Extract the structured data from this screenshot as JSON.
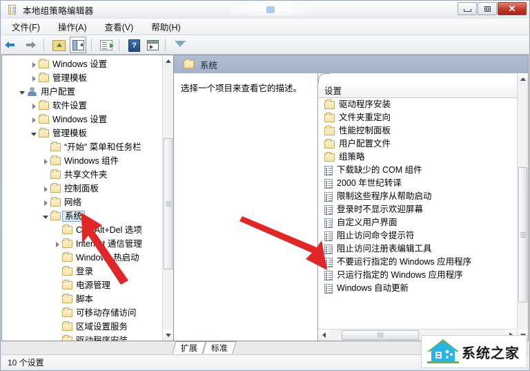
{
  "window": {
    "title": "本地组策略编辑器",
    "icon": "document-policy-icon",
    "controls": {
      "minimize": "–",
      "maximize": "□",
      "close": "✕"
    }
  },
  "menubar": {
    "items": [
      {
        "label": "文件(F)",
        "name": "menu-file"
      },
      {
        "label": "操作(A)",
        "name": "menu-action"
      },
      {
        "label": "查看(V)",
        "name": "menu-view"
      },
      {
        "label": "帮助(H)",
        "name": "menu-help"
      }
    ]
  },
  "toolbar": {
    "buttons": [
      {
        "name": "back-button",
        "icon": "arrow-left-icon"
      },
      {
        "name": "forward-button",
        "icon": "arrow-right-icon"
      },
      {
        "name": "up-one-level-button",
        "icon": "folder-up-icon"
      },
      {
        "name": "show-hide-console-tree-button",
        "icon": "console-tree-icon"
      },
      {
        "name": "export-list-button",
        "icon": "export-list-icon"
      },
      {
        "name": "help-button",
        "icon": "help-question-icon"
      },
      {
        "name": "show-hide-action-pane-button",
        "icon": "action-pane-icon"
      },
      {
        "name": "filter-button",
        "icon": "filter-funnel-icon"
      }
    ]
  },
  "tree": {
    "items": [
      {
        "label": "Windows 设置",
        "indent": 2,
        "expander": "closed",
        "icon": "folder-icon",
        "selected": false
      },
      {
        "label": "管理模板",
        "indent": 2,
        "expander": "closed",
        "icon": "folder-icon",
        "selected": false
      },
      {
        "label": "用户配置",
        "indent": 1,
        "expander": "open",
        "icon": "user-config-icon",
        "selected": false
      },
      {
        "label": "软件设置",
        "indent": 2,
        "expander": "closed",
        "icon": "folder-icon",
        "selected": false
      },
      {
        "label": "Windows 设置",
        "indent": 2,
        "expander": "closed",
        "icon": "folder-icon",
        "selected": false
      },
      {
        "label": "管理模板",
        "indent": 2,
        "expander": "open",
        "icon": "folder-icon",
        "selected": false
      },
      {
        "label": "“开始” 菜单和任务栏",
        "indent": 3,
        "expander": "none",
        "icon": "folder-icon",
        "selected": false
      },
      {
        "label": "Windows 组件",
        "indent": 3,
        "expander": "closed",
        "icon": "folder-icon",
        "selected": false
      },
      {
        "label": "共享文件夹",
        "indent": 3,
        "expander": "none",
        "icon": "folder-icon",
        "selected": false
      },
      {
        "label": "控制面板",
        "indent": 3,
        "expander": "closed",
        "icon": "folder-icon",
        "selected": false
      },
      {
        "label": "网络",
        "indent": 3,
        "expander": "closed",
        "icon": "folder-icon",
        "selected": false
      },
      {
        "label": "系统",
        "indent": 3,
        "expander": "open",
        "icon": "folder-icon",
        "selected": true
      },
      {
        "label": "Ctrl+Alt+Del 选项",
        "indent": 4,
        "expander": "none",
        "icon": "folder-icon",
        "selected": false
      },
      {
        "label": "Internet 通信管理",
        "indent": 4,
        "expander": "closed",
        "icon": "folder-icon",
        "selected": false
      },
      {
        "label": "Windows 热启动",
        "indent": 4,
        "expander": "none",
        "icon": "folder-icon",
        "selected": false
      },
      {
        "label": "登录",
        "indent": 4,
        "expander": "none",
        "icon": "folder-icon",
        "selected": false
      },
      {
        "label": "电源管理",
        "indent": 4,
        "expander": "none",
        "icon": "folder-icon",
        "selected": false
      },
      {
        "label": "脚本",
        "indent": 4,
        "expander": "none",
        "icon": "folder-icon",
        "selected": false
      },
      {
        "label": "可移动存储访问",
        "indent": 4,
        "expander": "none",
        "icon": "folder-icon",
        "selected": false
      },
      {
        "label": "区域设置服务",
        "indent": 4,
        "expander": "none",
        "icon": "folder-icon",
        "selected": false
      },
      {
        "label": "驱动程序安装",
        "indent": 4,
        "expander": "none",
        "icon": "folder-icon",
        "selected": false
      }
    ]
  },
  "right_panel": {
    "header_title": "系统",
    "header_icon": "folder-icon",
    "description": "选择一个项目来查看它的描述。",
    "list_header": "设置",
    "items": [
      {
        "label": "驱动程序安装",
        "icon": "folder-icon"
      },
      {
        "label": "文件夹重定向",
        "icon": "folder-icon"
      },
      {
        "label": "性能控制面板",
        "icon": "folder-icon"
      },
      {
        "label": "用户配置文件",
        "icon": "folder-icon"
      },
      {
        "label": "组策略",
        "icon": "folder-icon"
      },
      {
        "label": "下载缺少的 COM 组件",
        "icon": "setting-doc-icon"
      },
      {
        "label": "2000 年世纪转译",
        "icon": "setting-doc-icon"
      },
      {
        "label": "限制这些程序从帮助启动",
        "icon": "setting-doc-icon"
      },
      {
        "label": "登录时不显示欢迎屏幕",
        "icon": "setting-doc-icon"
      },
      {
        "label": "自定义用户界面",
        "icon": "setting-doc-icon"
      },
      {
        "label": "阻止访问命令提示符",
        "icon": "setting-doc-icon"
      },
      {
        "label": "阻止访问注册表编辑工具",
        "icon": "setting-doc-icon"
      },
      {
        "label": "不要运行指定的 Windows 应用程序",
        "icon": "setting-doc-icon"
      },
      {
        "label": "只运行指定的 Windows 应用程序",
        "icon": "setting-doc-icon"
      },
      {
        "label": "Windows 自动更新",
        "icon": "setting-doc-icon"
      }
    ]
  },
  "tabs": [
    {
      "label": "扩展",
      "name": "tab-extended",
      "active": false
    },
    {
      "label": "标准",
      "name": "tab-standard",
      "active": true
    }
  ],
  "statusbar": {
    "text": "10 个设置"
  },
  "watermark": {
    "text": "系统之家",
    "logo": "house-logo-icon"
  },
  "annotations": {
    "arrow1": {
      "name": "red-arrow-to-system-node",
      "color": "#e02727"
    },
    "arrow2": {
      "name": "red-arrow-to-registry-setting",
      "color": "#e02727"
    }
  },
  "colors": {
    "header_bar": "#a8b6cb",
    "selection": "#dce9f7",
    "accent_red": "#e02727",
    "close_button": "#c0392b"
  }
}
